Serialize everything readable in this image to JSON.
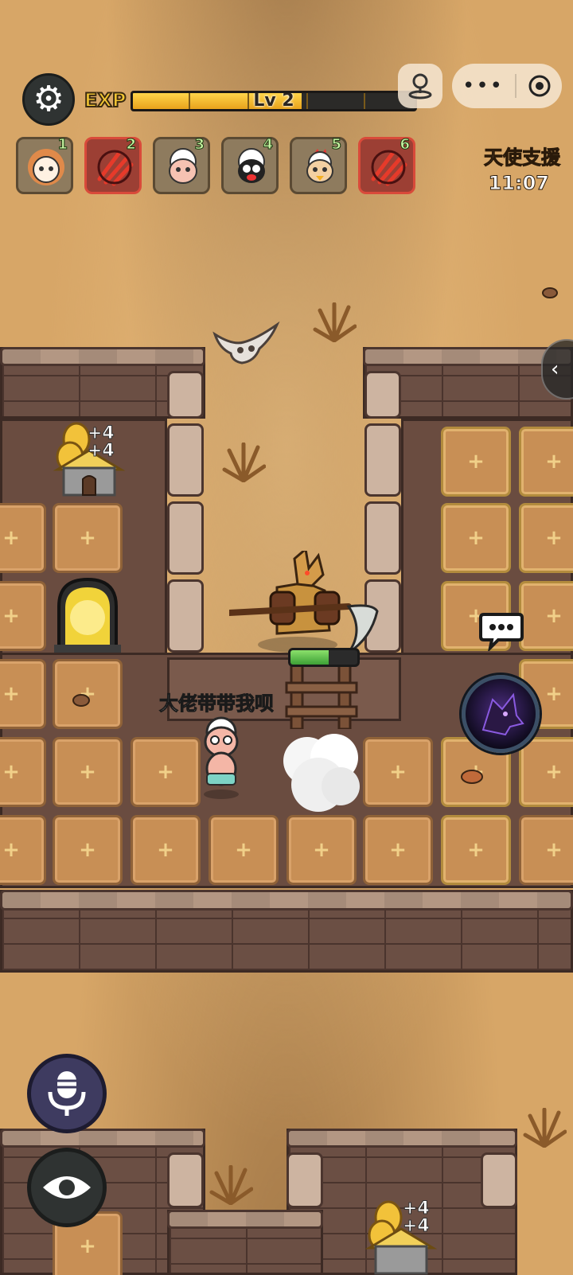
{
  "hud": {
    "exp_label": "EXP",
    "level_text": "Lv 2",
    "exp_progress": 0.6,
    "angel_support_title": "天使支援",
    "angel_support_timer": "11:07"
  },
  "team": [
    {
      "num": "1",
      "kind": "sheep-lion"
    },
    {
      "num": "2",
      "kind": "enemy-claw"
    },
    {
      "num": "3",
      "kind": "sheep"
    },
    {
      "num": "4",
      "kind": "sheep-black"
    },
    {
      "num": "5",
      "kind": "sheep-rooster"
    },
    {
      "num": "6",
      "kind": "enemy-claw"
    }
  ],
  "player": {
    "chat_text": "大佬带带我呗"
  },
  "boss": {
    "hp_fraction": 0.57
  },
  "pickups": [
    {
      "label_a": "+4",
      "label_b": "+4"
    },
    {
      "label_a": "+4",
      "label_b": "+4"
    }
  ],
  "icons": {
    "settings": "gear-icon",
    "joystick": "joystick-icon",
    "more": "more-dots-icon",
    "record": "record-icon",
    "collapse": "chevron-left-icon",
    "chat": "speech-bubble-icon",
    "skill": "wolf-skill-icon",
    "mic": "microphone-icon",
    "eye": "eye-icon"
  },
  "colors": {
    "sand": "#d7a667",
    "exp_fill": "#f6c933",
    "enemy_slot": "#d94a3a",
    "hp_green": "#3da035"
  }
}
